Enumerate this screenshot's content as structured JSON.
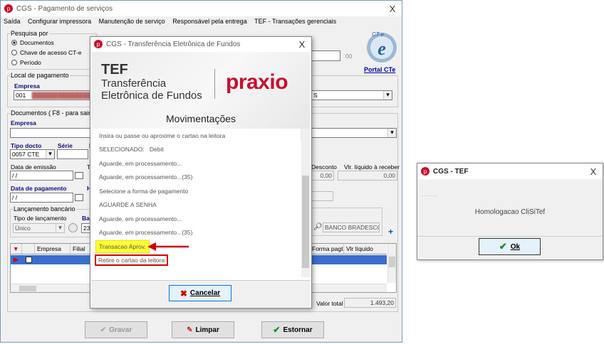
{
  "main_window": {
    "title": "CGS - Pagamento de serviços",
    "close_glyph": "X",
    "menu": [
      "Saída",
      "Configurar impressora",
      "Manutenção de serviço",
      "Responsável pela entrega",
      "TEF - Transações gerenciais"
    ],
    "pesquisa": {
      "legend": "Pesquisa por",
      "options": [
        "Documentos",
        "Chave de acesso CT-e",
        "Período"
      ],
      "selected": "Documentos"
    },
    "search_suffix": "00",
    "logo_text": "CT-e",
    "portal_link": "Portal CTe",
    "local": {
      "legend": "Local de pagamento",
      "empresa_label": "Empresa",
      "empresa_value": "001",
      "empresa_right": "S"
    },
    "documentos": {
      "legend": "Documentos ( F8 - para sair )",
      "empresa_label": "Empresa",
      "tipo_docto_label": "Tipo docto",
      "tipo_docto_value": "0057 CTE",
      "serie_label": "Série",
      "col_i": "I",
      "data_emissao_label": "Data de emissão",
      "data_emissao_value": "/ /",
      "col_t": "T",
      "data_pagamento_label": "Data de pagamento",
      "data_pagamento_value": "/ /",
      "col_h": "H",
      "desconto_label": "Desconto",
      "desconto_value": "0,00",
      "vlr_liquido_label": "Vlr. líquido à receber",
      "vlr_liquido_value": "0,00"
    },
    "lancamento": {
      "legend": "Lançamento bancário",
      "tipo_label": "Tipo de lançamento",
      "tipo_value": "Único",
      "ban_label": "Ban",
      "ban_value": "237",
      "bank_name": "BANCO BRADESCO",
      "plus": "+"
    },
    "grid": {
      "headers": [
        "Empresa",
        "Filial",
        "Forma pagto",
        "Vlr líquido"
      ]
    },
    "valor_total_label": "Valor total",
    "valor_total_value": "1.493,20",
    "buttons": {
      "gravar": "Gravar",
      "limpar": "Limpar",
      "estornar": "Estornar"
    }
  },
  "tef_dialog": {
    "title": "CGS - Transferência Eletrônica de Fundos",
    "close_glyph": "X",
    "brand_big": "TEF",
    "brand_line1": "Transferência",
    "brand_line2": "Eletrônica de Fundos",
    "brand_logo": "praxio",
    "section_title": "Movimentações",
    "messages": [
      "Insira ou passe ou aproxime o cartao na leitora",
      "SELECIONADO:   Debit",
      "Aguarde, em processamento...",
      "Aguarde, em processamento...(35)",
      "Selecione a forma de pagamento",
      "AGUARDE A SENHA",
      "Aguarde, em processamento...",
      "Aguarde, em processamento...(35)",
      "Transacao Aprov.",
      "Retire o cartao da leitora"
    ],
    "cancel_label": "Cancelar"
  },
  "tef_small": {
    "title": "CGS - TEF",
    "close_glyph": "X",
    "dots": ". . . . . .",
    "message": "Homologacao CliSiTef",
    "ok_label": "Ok"
  },
  "colors": {
    "praxio_red": "#c8102e",
    "highlight_yellow": "#ffff33",
    "annotation_red": "#d40000"
  }
}
